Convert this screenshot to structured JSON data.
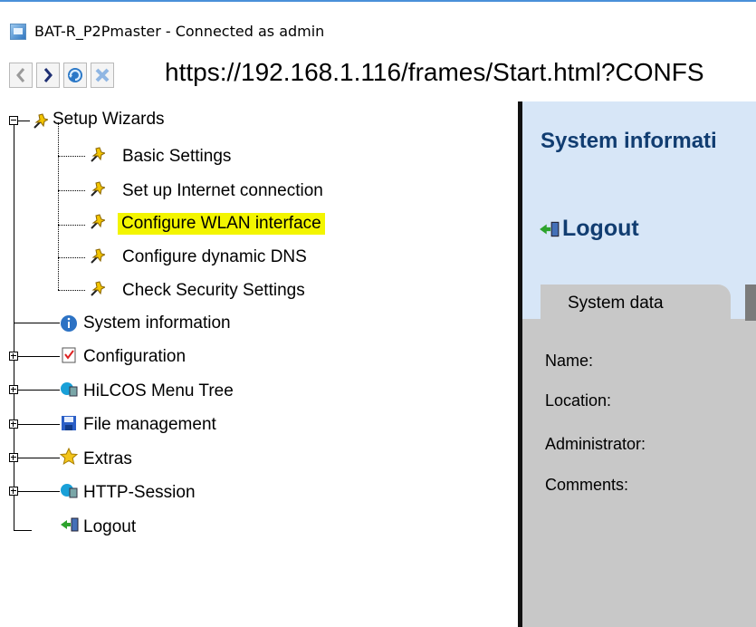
{
  "window": {
    "title": "BAT-R_P2Pmaster - Connected as admin"
  },
  "navbar": {
    "url": "https://192.168.1.116/frames/Start.html?CONFS",
    "buttons": [
      "back-icon",
      "forward-icon",
      "refresh-icon",
      "stop-icon"
    ]
  },
  "tree": {
    "setup_wizards": "Setup Wizards",
    "basic_settings": "Basic Settings",
    "internet": "Set up Internet connection",
    "wlan": "Configure WLAN interface",
    "dns": "Configure dynamic DNS",
    "security": "Check Security Settings",
    "system_information": "System information",
    "configuration": "Configuration",
    "hilcos": "HiLCOS Menu Tree",
    "file_management": "File management",
    "extras": "Extras",
    "http_session": "HTTP-Session",
    "logout": "Logout"
  },
  "main": {
    "title": "System informati",
    "logout": "Logout",
    "tab_system_data": "System data",
    "fields": [
      "Name:",
      "Location:",
      "Administrator:",
      "Comments:"
    ]
  },
  "colors": {
    "highlight": "#f3f500",
    "heading": "#113d71",
    "panel": "#d7e6f7",
    "content": "#c8c8c8"
  }
}
